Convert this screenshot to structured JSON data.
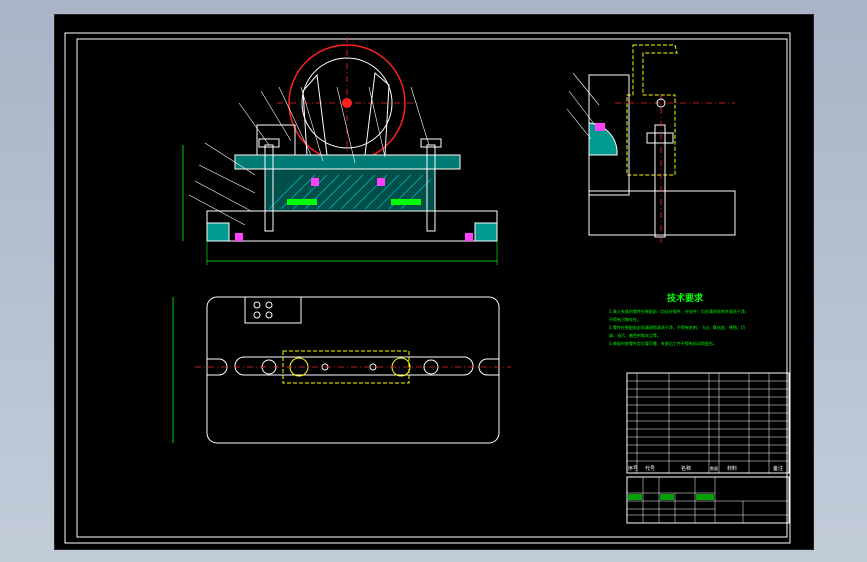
{
  "drawing": {
    "colors": {
      "frame": "#ffffff",
      "body": "#ffffff",
      "hatch": "#00c8c8",
      "part_fill": "#009a90",
      "green": "#00ff00",
      "red": "#ff2020",
      "yellow": "#ffff00",
      "magenta": "#ff40ff",
      "dim": "#00ff00"
    },
    "technical_requirements": {
      "title": "技术要求",
      "lines": [
        "1.装入夹具的零件在装配前（包括外购件、外协件）均应清除毛刺并清洗干净，",
        "不得有污物存在。",
        "2.零件在装配前必须清理和清洗干净，不得有毛刺、飞边、氧化皮、锈蚀、切",
        "屑、油污、着色剂和灰尘等。",
        "3.装配时各零件定位要可靠，夹紧后工件不得有松动和变形。"
      ]
    },
    "bom_header": [
      "序号",
      "代号",
      "名称",
      "数量",
      "材料",
      "备注"
    ]
  }
}
